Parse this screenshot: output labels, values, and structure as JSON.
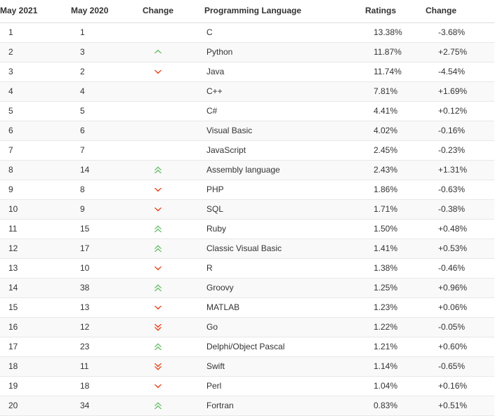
{
  "table": {
    "headers": {
      "rank_new": "May 2021",
      "rank_old": "May 2020",
      "change": "Change",
      "language": "Programming Language",
      "ratings": "Ratings",
      "delta": "Change"
    },
    "colors": {
      "up": "#6cbf6c",
      "down": "#e8441a",
      "text": "#333333",
      "row_alt_background": "#f9f9f9",
      "row_background": "#ffffff",
      "border": "#e8e8e8",
      "header_border": "#dddddd"
    },
    "rows": [
      {
        "rank_new": "1",
        "rank_old": "1",
        "change": "none",
        "change_icon": "",
        "language": "C",
        "ratings": "13.38%",
        "delta": "-3.68%"
      },
      {
        "rank_new": "2",
        "rank_old": "3",
        "change": "up",
        "change_icon": "chevron-up-icon",
        "language": "Python",
        "ratings": "11.87%",
        "delta": "+2.75%"
      },
      {
        "rank_new": "3",
        "rank_old": "2",
        "change": "down",
        "change_icon": "chevron-down-icon",
        "language": "Java",
        "ratings": "11.74%",
        "delta": "-4.54%"
      },
      {
        "rank_new": "4",
        "rank_old": "4",
        "change": "none",
        "change_icon": "",
        "language": "C++",
        "ratings": "7.81%",
        "delta": "+1.69%"
      },
      {
        "rank_new": "5",
        "rank_old": "5",
        "change": "none",
        "change_icon": "",
        "language": "C#",
        "ratings": "4.41%",
        "delta": "+0.12%"
      },
      {
        "rank_new": "6",
        "rank_old": "6",
        "change": "none",
        "change_icon": "",
        "language": "Visual Basic",
        "ratings": "4.02%",
        "delta": "-0.16%"
      },
      {
        "rank_new": "7",
        "rank_old": "7",
        "change": "none",
        "change_icon": "",
        "language": "JavaScript",
        "ratings": "2.45%",
        "delta": "-0.23%"
      },
      {
        "rank_new": "8",
        "rank_old": "14",
        "change": "up-double",
        "change_icon": "double-chevron-up-icon",
        "language": "Assembly language",
        "ratings": "2.43%",
        "delta": "+1.31%"
      },
      {
        "rank_new": "9",
        "rank_old": "8",
        "change": "down",
        "change_icon": "chevron-down-icon",
        "language": "PHP",
        "ratings": "1.86%",
        "delta": "-0.63%"
      },
      {
        "rank_new": "10",
        "rank_old": "9",
        "change": "down",
        "change_icon": "chevron-down-icon",
        "language": "SQL",
        "ratings": "1.71%",
        "delta": "-0.38%"
      },
      {
        "rank_new": "11",
        "rank_old": "15",
        "change": "up-double",
        "change_icon": "double-chevron-up-icon",
        "language": "Ruby",
        "ratings": "1.50%",
        "delta": "+0.48%"
      },
      {
        "rank_new": "12",
        "rank_old": "17",
        "change": "up-double",
        "change_icon": "double-chevron-up-icon",
        "language": "Classic Visual Basic",
        "ratings": "1.41%",
        "delta": "+0.53%"
      },
      {
        "rank_new": "13",
        "rank_old": "10",
        "change": "down",
        "change_icon": "chevron-down-icon",
        "language": "R",
        "ratings": "1.38%",
        "delta": "-0.46%"
      },
      {
        "rank_new": "14",
        "rank_old": "38",
        "change": "up-double",
        "change_icon": "double-chevron-up-icon",
        "language": "Groovy",
        "ratings": "1.25%",
        "delta": "+0.96%"
      },
      {
        "rank_new": "15",
        "rank_old": "13",
        "change": "down",
        "change_icon": "chevron-down-icon",
        "language": "MATLAB",
        "ratings": "1.23%",
        "delta": "+0.06%"
      },
      {
        "rank_new": "16",
        "rank_old": "12",
        "change": "down-double",
        "change_icon": "double-chevron-down-icon",
        "language": "Go",
        "ratings": "1.22%",
        "delta": "-0.05%"
      },
      {
        "rank_new": "17",
        "rank_old": "23",
        "change": "up-double",
        "change_icon": "double-chevron-up-icon",
        "language": "Delphi/Object Pascal",
        "ratings": "1.21%",
        "delta": "+0.60%"
      },
      {
        "rank_new": "18",
        "rank_old": "11",
        "change": "down-double",
        "change_icon": "double-chevron-down-icon",
        "language": "Swift",
        "ratings": "1.14%",
        "delta": "-0.65%"
      },
      {
        "rank_new": "19",
        "rank_old": "18",
        "change": "down",
        "change_icon": "chevron-down-icon",
        "language": "Perl",
        "ratings": "1.04%",
        "delta": "+0.16%"
      },
      {
        "rank_new": "20",
        "rank_old": "34",
        "change": "up-double",
        "change_icon": "double-chevron-up-icon",
        "language": "Fortran",
        "ratings": "0.83%",
        "delta": "+0.51%"
      }
    ]
  }
}
